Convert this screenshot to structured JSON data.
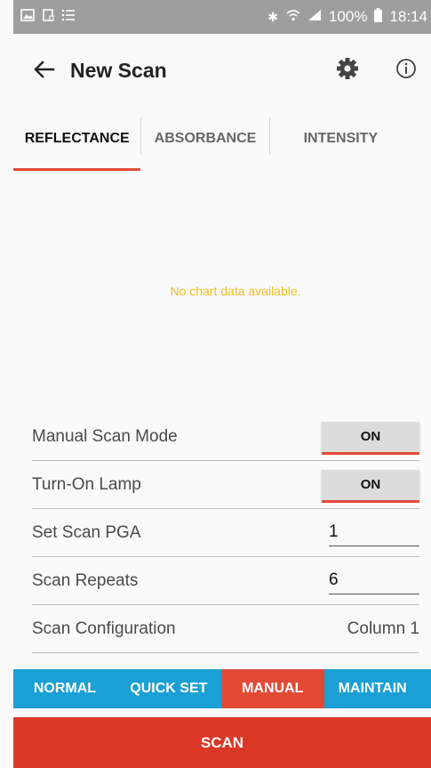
{
  "status_bar": {
    "left_icons": [
      "image-icon",
      "notification-icon",
      "list-icon"
    ],
    "right_icons": [
      "bluetooth-icon",
      "wifi-icon",
      "signal-icon",
      "battery-icon"
    ],
    "battery": "100%",
    "time": "18:14"
  },
  "app_bar": {
    "title": "New Scan",
    "back_icon": "arrow-back-icon",
    "settings_icon": "gear-icon",
    "info_icon": "info-icon"
  },
  "tabs": [
    {
      "label": "REFLECTANCE",
      "active": true
    },
    {
      "label": "ABSORBANCE",
      "active": false
    },
    {
      "label": "INTENSITY",
      "active": false
    }
  ],
  "chart": {
    "empty_message": "No chart data available."
  },
  "settings": {
    "manual_scan_mode": {
      "label": "Manual Scan Mode",
      "value": "ON"
    },
    "turn_on_lamp": {
      "label": "Turn-On Lamp",
      "value": "ON"
    },
    "scan_pga": {
      "label": "Set Scan PGA",
      "value": "1"
    },
    "scan_repeats": {
      "label": "Scan Repeats",
      "value": "6"
    },
    "scan_configuration": {
      "label": "Scan Configuration",
      "value": "Column 1"
    }
  },
  "modes": [
    {
      "label": "NORMAL",
      "active": false
    },
    {
      "label": "QUICK SET",
      "active": false
    },
    {
      "label": "MANUAL",
      "active": true
    },
    {
      "label": "MAINTAIN",
      "active": false
    }
  ],
  "scan_button": {
    "label": "SCAN"
  },
  "colors": {
    "accent": "#e34a36",
    "mode_bar": "#1aa0d4",
    "scan_button": "#db3727",
    "empty_message": "#f2bd1e",
    "status_bar": "#9e9e9e"
  }
}
